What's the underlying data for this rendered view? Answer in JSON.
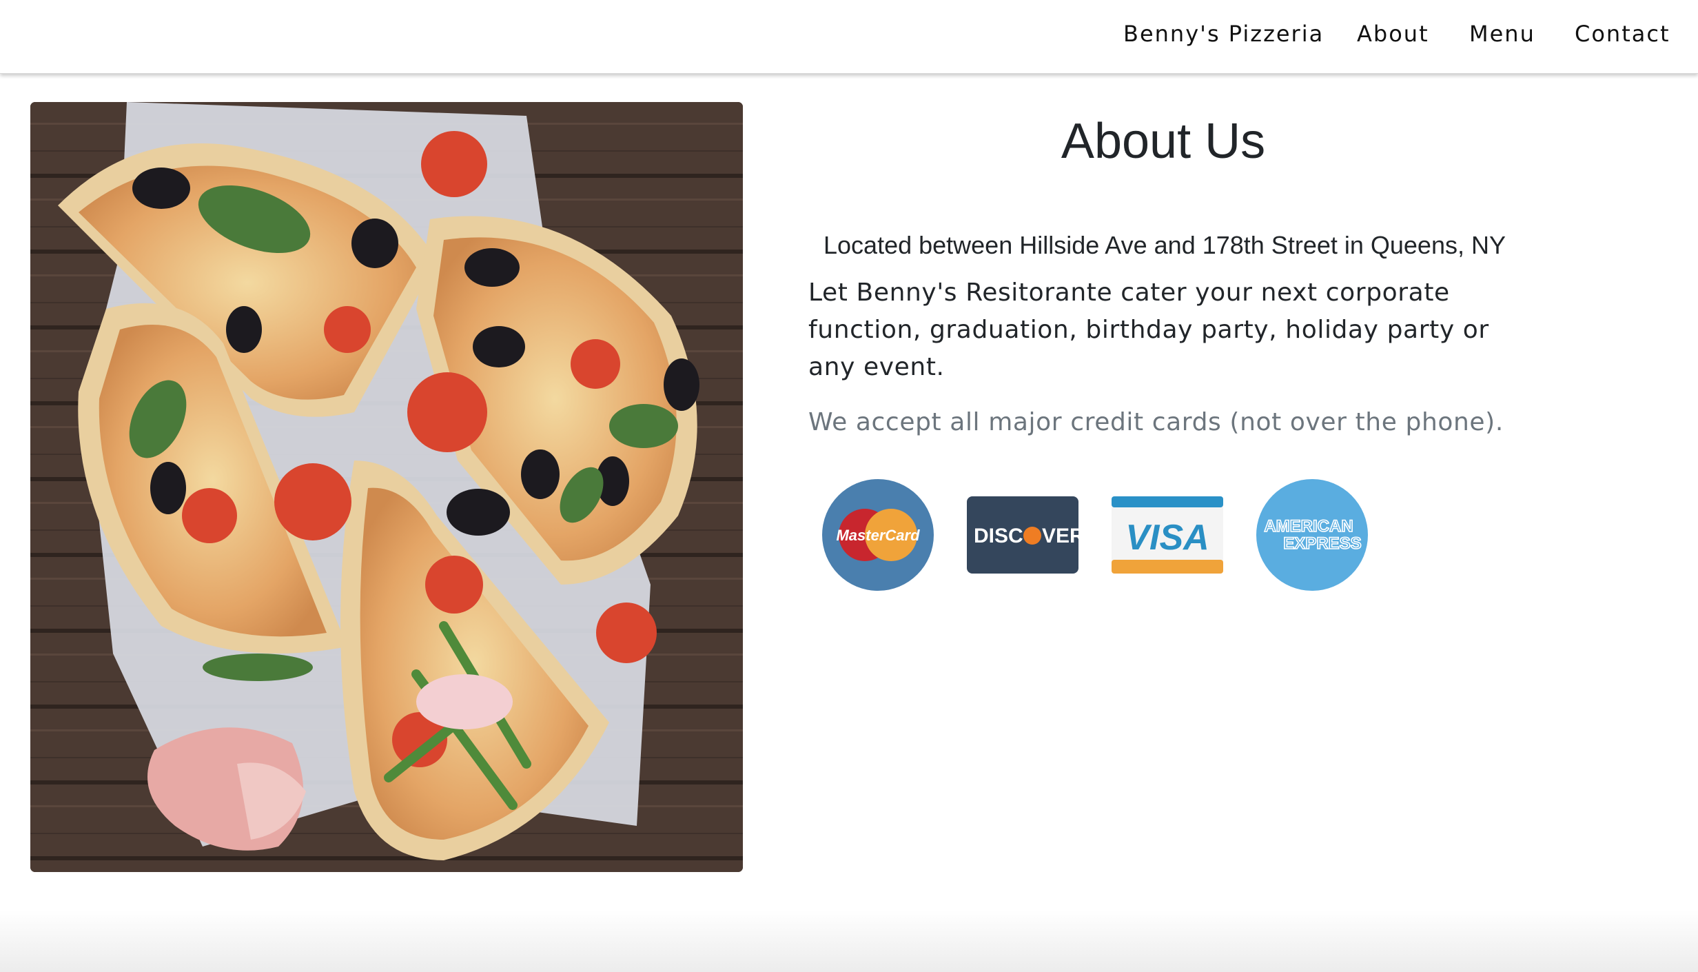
{
  "nav": {
    "brand": "Benny's Pizzeria",
    "items": [
      "About",
      "Menu",
      "Contact"
    ]
  },
  "about": {
    "title": "About Us",
    "location": "Located between Hillside Ave and 178th Street in Queens, NY",
    "cater": "Let Benny's Resitorante cater your next corporate function, graduation, birthday party, holiday party or any event.",
    "cards_note": "We accept all major credit cards (not over the phone)."
  },
  "cards": {
    "mastercard": "MasterCard",
    "discover_left": "DISC",
    "discover_right": "VER",
    "visa": "VISA",
    "amex_top": "AMERICAN",
    "amex_bottom": "EXPRESS"
  },
  "colors": {
    "mastercard_bg": "#4a7fae",
    "discover_bg": "#34465c",
    "visa_blue": "#2a91c7",
    "visa_gold": "#f0a33a",
    "amex_bg": "#5aade0"
  }
}
